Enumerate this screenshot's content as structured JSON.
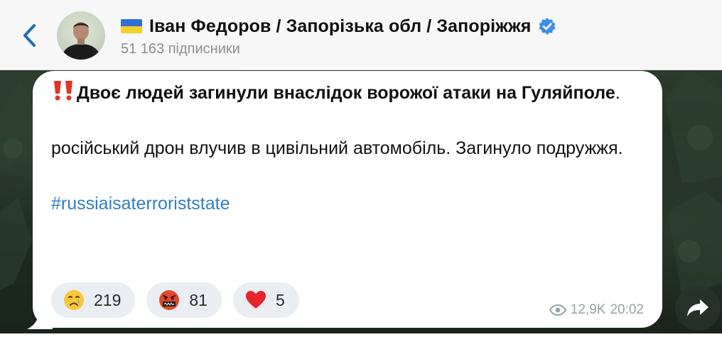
{
  "header": {
    "channel_title": "Іван Федоров / Запорізька обл / Запоріжжя",
    "subscribers": "51 163 підписники",
    "flag_icon": "ukraine-flag-icon",
    "verified_icon": "verified-badge-icon",
    "back_icon": "chevron-left-icon",
    "accent_color": "#2f7fc3"
  },
  "message": {
    "alert_icon": "double-exclamation-icon",
    "headline": "Двоє людей загинули внаслідок ворожої атаки на Гуляйполе",
    "headline_suffix": ".",
    "body": "російський дрон влучив в цивільний автомобіль. Загинуло подружжя.",
    "hashtag": "#russiaisaterroriststate",
    "reactions": [
      {
        "icon": "crying-face-icon",
        "count": "219"
      },
      {
        "icon": "cursing-face-icon",
        "count": "81"
      },
      {
        "icon": "red-heart-icon",
        "count": "5"
      }
    ],
    "views": "12,9K",
    "time": "20:02"
  }
}
